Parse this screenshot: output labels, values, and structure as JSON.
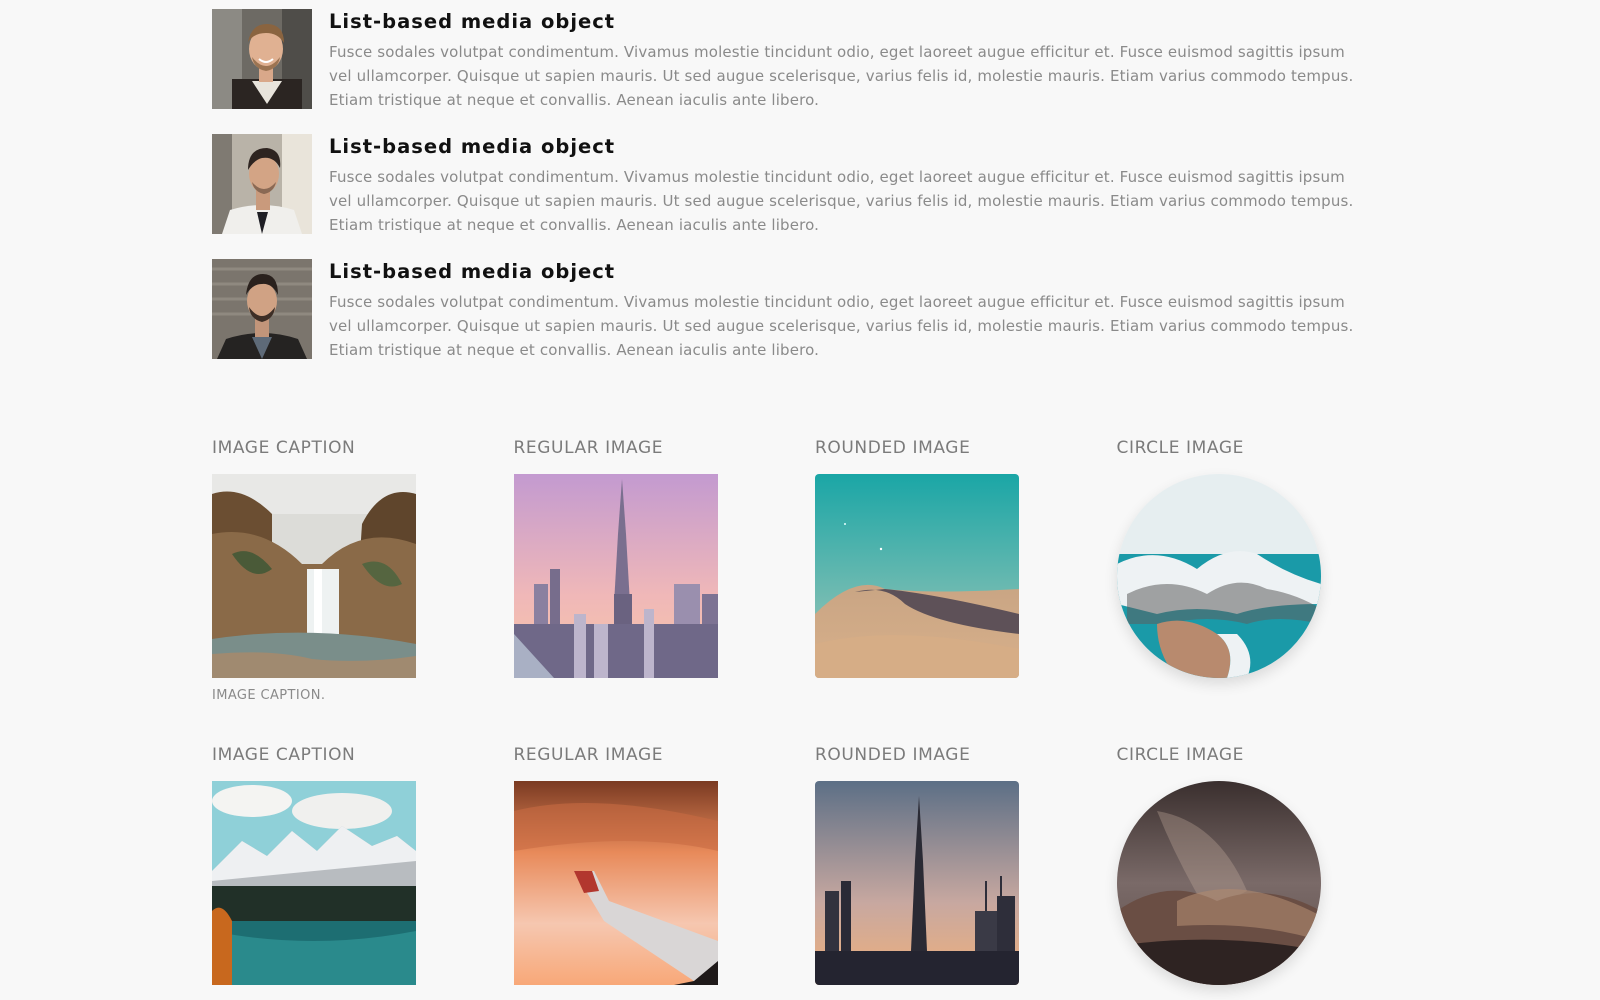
{
  "media_items": [
    {
      "title": "List-based media object",
      "text": "Fusce sodales volutpat condimentum. Vivamus molestie tincidunt odio, eget laoreet augue efficitur et. Fusce euismod sagittis ipsum vel ullamcorper. Quisque ut sapien mauris. Ut sed augue scelerisque, varius felis id, molestie mauris. Etiam varius commodo tempus. Etiam tristique at neque et convallis. Aenean iaculis ante libero."
    },
    {
      "title": "List-based media object",
      "text": "Fusce sodales volutpat condimentum. Vivamus molestie tincidunt odio, eget laoreet augue efficitur et. Fusce euismod sagittis ipsum vel ullamcorper. Quisque ut sapien mauris. Ut sed augue scelerisque, varius felis id, molestie mauris. Etiam varius commodo tempus. Etiam tristique at neque et convallis. Aenean iaculis ante libero."
    },
    {
      "title": "List-based media object",
      "text": "Fusce sodales volutpat condimentum. Vivamus molestie tincidunt odio, eget laoreet augue efficitur et. Fusce euismod sagittis ipsum vel ullamcorper. Quisque ut sapien mauris. Ut sed augue scelerisque, varius felis id, molestie mauris. Etiam varius commodo tempus. Etiam tristique at neque et convallis. Aenean iaculis ante libero."
    }
  ],
  "image_rows": [
    {
      "cells": [
        {
          "label": "IMAGE CAPTION",
          "caption": "IMAGE CAPTION.",
          "image": "waterfall-photo"
        },
        {
          "label": "REGULAR IMAGE",
          "image": "city-tower-sunset-photo"
        },
        {
          "label": "ROUNDED IMAGE",
          "image": "desert-dune-photo"
        },
        {
          "label": "CIRCLE IMAGE",
          "image": "snowy-coast-photo"
        }
      ]
    },
    {
      "cells": [
        {
          "label": "IMAGE CAPTION",
          "image": "mountain-lake-photo"
        },
        {
          "label": "REGULAR IMAGE",
          "image": "airplane-wing-photo"
        },
        {
          "label": "ROUNDED IMAGE",
          "image": "city-tower-dusk-photo"
        },
        {
          "label": "CIRCLE IMAGE",
          "image": "stormy-hills-photo"
        }
      ]
    }
  ],
  "colors": {
    "page_background": "#f8f8f8",
    "title_text": "#111111",
    "body_text": "#8a8a8a",
    "label_text": "#7b7b7b"
  }
}
